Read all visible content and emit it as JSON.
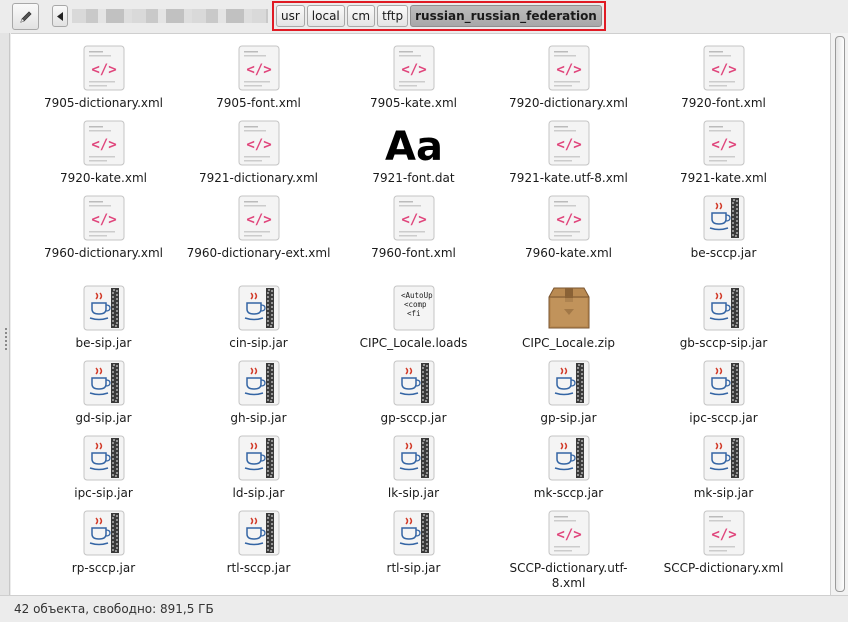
{
  "toolbar": {
    "edit_icon": "pencil-icon",
    "back_icon": "left-arrow-icon",
    "breadcrumb": [
      "usr",
      "local",
      "cm",
      "tftp",
      "russian_russian_federation"
    ]
  },
  "files": [
    {
      "name": "7905-dictionary.xml",
      "type": "xml"
    },
    {
      "name": "7905-font.xml",
      "type": "xml"
    },
    {
      "name": "7905-kate.xml",
      "type": "xml"
    },
    {
      "name": "7920-dictionary.xml",
      "type": "xml"
    },
    {
      "name": "7920-font.xml",
      "type": "xml"
    },
    {
      "name": "7920-kate.xml",
      "type": "xml"
    },
    {
      "name": "7921-dictionary.xml",
      "type": "xml"
    },
    {
      "name": "7921-font.dat",
      "type": "font",
      "glyph": "Aa"
    },
    {
      "name": "7921-kate.utf-8.xml",
      "type": "xml"
    },
    {
      "name": "7921-kate.xml",
      "type": "xml"
    },
    {
      "name": "7960-dictionary.xml",
      "type": "xml"
    },
    {
      "name": "7960-dictionary-ext.xml",
      "type": "xml"
    },
    {
      "name": "7960-font.xml",
      "type": "xml"
    },
    {
      "name": "7960-kate.xml",
      "type": "xml"
    },
    {
      "name": "be-sccp.jar",
      "type": "jar"
    },
    {
      "name": "be-sip.jar",
      "type": "jar"
    },
    {
      "name": "cin-sip.jar",
      "type": "jar"
    },
    {
      "name": "CIPC_Locale.loads",
      "type": "text",
      "preview": [
        "<AutoUp",
        "<comp",
        "<fi"
      ]
    },
    {
      "name": "CIPC_Locale.zip",
      "type": "zip"
    },
    {
      "name": "gb-sccp-sip.jar",
      "type": "jar"
    },
    {
      "name": "gd-sip.jar",
      "type": "jar"
    },
    {
      "name": "gh-sip.jar",
      "type": "jar"
    },
    {
      "name": "gp-sccp.jar",
      "type": "jar"
    },
    {
      "name": "gp-sip.jar",
      "type": "jar"
    },
    {
      "name": "ipc-sccp.jar",
      "type": "jar"
    },
    {
      "name": "ipc-sip.jar",
      "type": "jar"
    },
    {
      "name": "ld-sip.jar",
      "type": "jar"
    },
    {
      "name": "lk-sip.jar",
      "type": "jar"
    },
    {
      "name": "mk-sccp.jar",
      "type": "jar"
    },
    {
      "name": "mk-sip.jar",
      "type": "jar"
    },
    {
      "name": "rp-sccp.jar",
      "type": "jar"
    },
    {
      "name": "rtl-sccp.jar",
      "type": "jar"
    },
    {
      "name": "rtl-sip.jar",
      "type": "jar"
    },
    {
      "name": "SCCP-dictionary.utf-8.xml",
      "type": "xml"
    },
    {
      "name": "SCCP-dictionary.xml",
      "type": "xml"
    }
  ],
  "status": {
    "text": "42 объекта, свободно: 891,5 ГБ"
  },
  "colors": {
    "breadcrumb_highlight": "#e01b24",
    "xml_accent": "#e0467c",
    "jar_accent": "#d23c2a"
  }
}
